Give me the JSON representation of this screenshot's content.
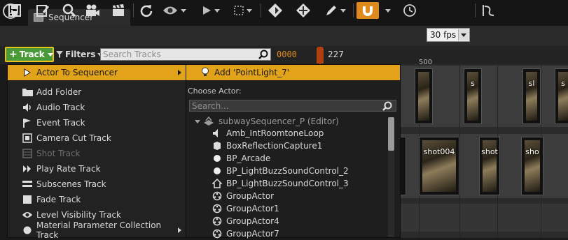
{
  "tab": {
    "title": "Sequencer",
    "icon": "film-strip-icon"
  },
  "logo": {
    "text": "u"
  },
  "toolbar": {
    "fps_value": "30 fps",
    "snap_color": "#e08a1e"
  },
  "filter_row": {
    "track_label": "Track",
    "filters_label": "Filters",
    "search_placeholder": "Search Tracks",
    "current_frame": "0000",
    "playhead_frame": "227",
    "ruler_label": "500"
  },
  "track_menu": {
    "items": [
      {
        "label": "Actor To Sequencer",
        "icon": "actor-icon",
        "selected": true,
        "submenu": true
      },
      {
        "label": "Add Folder",
        "icon": "folder-icon"
      },
      {
        "label": "Audio Track",
        "icon": "speaker-icon"
      },
      {
        "label": "Event Track",
        "icon": "flag-icon"
      },
      {
        "label": "Camera Cut Track",
        "icon": "camera-cut-icon"
      },
      {
        "label": "Shot Track",
        "icon": "film-icon",
        "disabled": true
      },
      {
        "label": "Play Rate Track",
        "icon": "play-rate-icon"
      },
      {
        "label": "Subscenes Track",
        "icon": "subscenes-icon"
      },
      {
        "label": "Fade Track",
        "icon": "fade-icon"
      },
      {
        "label": "Level Visibility Track",
        "icon": "eye-icon"
      },
      {
        "label": "Material Parameter Collection Track",
        "icon": "material-icon",
        "submenu": true
      }
    ]
  },
  "actor_menu": {
    "add_label": "Add 'PointLight_7'",
    "choose_label": "Choose Actor:",
    "search_placeholder": "Search...",
    "level_name": "subwaySequencer_P (Editor)",
    "actors": [
      {
        "label": "Amb_IntRoomtoneLoop",
        "icon": "ambient-sound-icon"
      },
      {
        "label": "BoxReflectionCapture1",
        "icon": "reflection-capture-icon"
      },
      {
        "label": "BP_Arcade",
        "icon": "sphere-icon"
      },
      {
        "label": "BP_LightBuzzSoundControl_2",
        "icon": "sphere-icon"
      },
      {
        "label": "BP_LightBuzzSoundControl_3",
        "icon": "house-icon"
      },
      {
        "label": "GroupActor",
        "icon": "group-icon"
      },
      {
        "label": "GroupActor1",
        "icon": "group-icon"
      },
      {
        "label": "GroupActor4",
        "icon": "group-icon"
      },
      {
        "label": "GroupActor7",
        "icon": "group-icon"
      }
    ]
  },
  "timeline": {
    "shots": [
      "s",
      "sl",
      "s",
      "shot004",
      "shot",
      "sho"
    ]
  }
}
